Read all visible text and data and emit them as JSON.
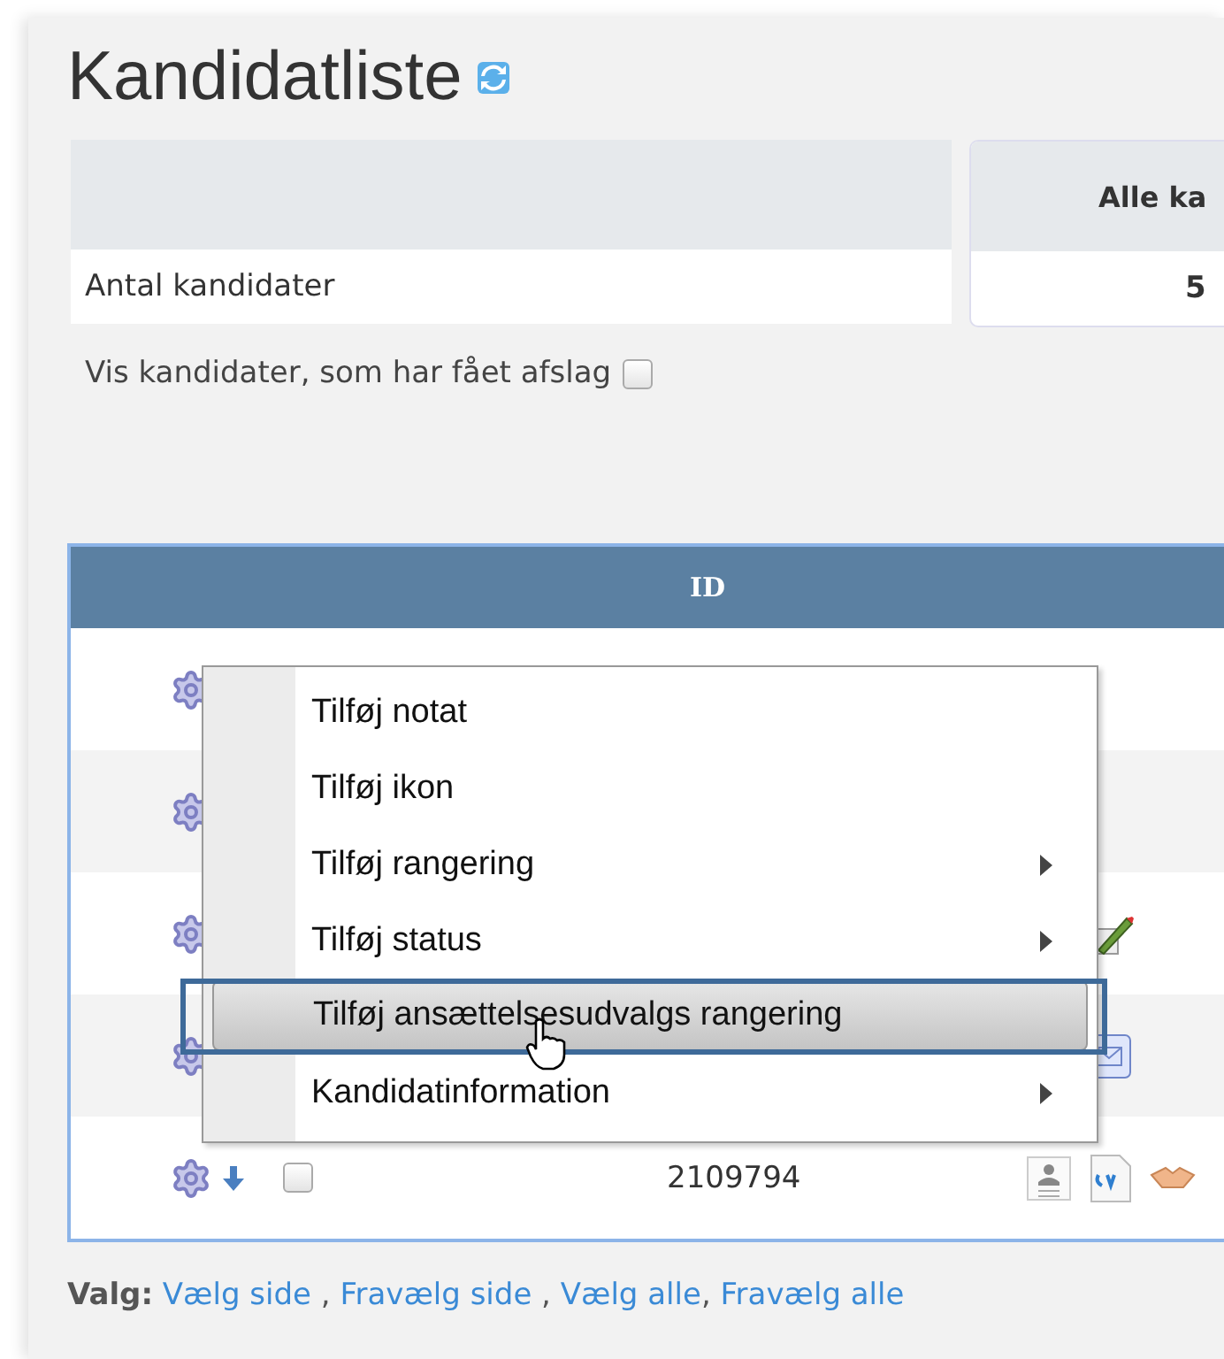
{
  "title": "Kandidatliste",
  "summary": {
    "column_2": "Alle ka",
    "rows": [
      {
        "label": "Antal kandidater",
        "value": "5"
      }
    ]
  },
  "rejected_filter": {
    "label": "Vis kandidater, som har fået afslag",
    "checked": false
  },
  "grid": {
    "columns": [
      "ID"
    ],
    "rows": [
      {},
      {},
      {},
      {},
      {
        "id": "2109794",
        "checked": false
      }
    ]
  },
  "context_menu": [
    {
      "label": "Tilføj notat",
      "submenu": false,
      "selected": false
    },
    {
      "label": "Tilføj ikon",
      "submenu": false,
      "selected": false
    },
    {
      "label": "Tilføj rangering",
      "submenu": true,
      "selected": false
    },
    {
      "label": "Tilføj status",
      "submenu": true,
      "selected": false
    },
    {
      "label": "Tilføj ansættelsesudvalgs rangering",
      "submenu": false,
      "selected": true
    },
    {
      "label": "Kandidatinformation",
      "submenu": true,
      "selected": false
    }
  ],
  "selection": {
    "label": "Valg:",
    "links": [
      {
        "text": "Vælg side",
        "separator": " ,"
      },
      {
        "text": "Fravælg side",
        "separator": " ,"
      },
      {
        "text": "Vælg alle",
        "separator": ","
      },
      {
        "text": "Fravælg alle"
      }
    ]
  }
}
